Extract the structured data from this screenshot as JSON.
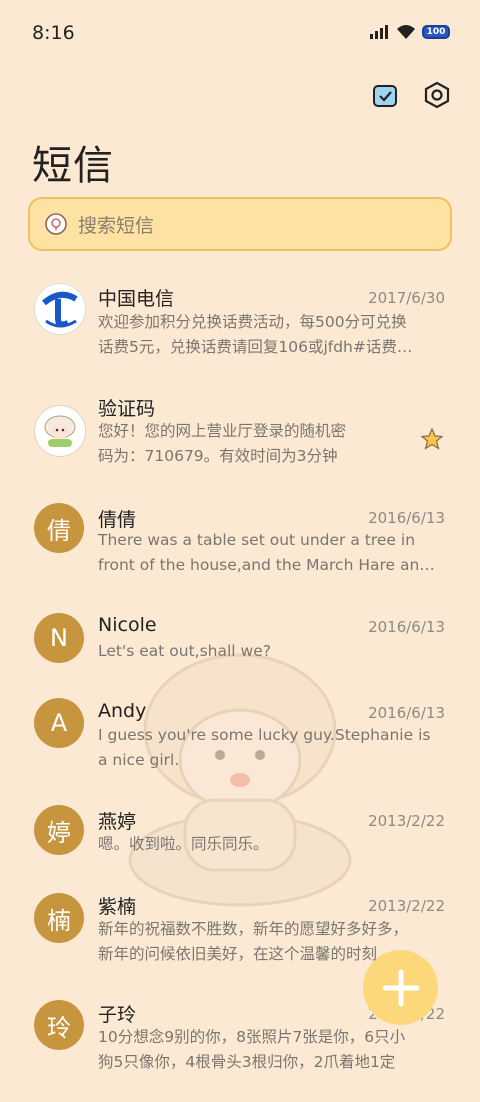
{
  "status": {
    "time": "8:16",
    "battery": "100"
  },
  "header": {
    "title": "短信"
  },
  "search": {
    "placeholder": "搜索短信"
  },
  "messages": [
    {
      "avatar": "",
      "name": "中国电信",
      "date": "2017/6/30",
      "line1": "欢迎参加积分兑换话费活动，每500分可兑换",
      "line2": "话费5元，兑换话费请回复106或jfdh#话费…"
    },
    {
      "avatar": "",
      "name": "验证码",
      "date": "",
      "line1": "您好！您的网上营业厅登录的随机密",
      "line2": "码为：710679。有效时间为3分钟"
    },
    {
      "avatar": "倩",
      "name": "倩倩",
      "date": "2016/6/13",
      "line1": "There was a table set out under a tree in",
      "line2": "front of the house,and the March Hare an…"
    },
    {
      "avatar": "N",
      "name": "Nicole",
      "date": "2016/6/13",
      "line1": "Let's eat out,shall we?",
      "line2": ""
    },
    {
      "avatar": "A",
      "name": "Andy",
      "date": "2016/6/13",
      "line1": "I guess you're some lucky guy.Stephanie is",
      "line2": "a nice girl."
    },
    {
      "avatar": "婷",
      "name": "燕婷",
      "date": "2013/2/22",
      "line1": "嗯。收到啦。同乐同乐。",
      "line2": ""
    },
    {
      "avatar": "楠",
      "name": "紫楠",
      "date": "2013/2/22",
      "line1": "新年的祝福数不胜数，新年的愿望好多好多，",
      "line2": "新年的问候依旧美好，在这个温馨的时刻…"
    },
    {
      "avatar": "玲",
      "name": "子玲",
      "date": "2013/2/22",
      "line1": "10分想念9别的你，8张照片7张是你，6只小",
      "line2": "狗5只像你，4根骨头3根归你，2爪着地1定"
    }
  ],
  "colors": {
    "accent": "#c8953f",
    "background": "#fbe9d3",
    "search_bg": "#fde2a4",
    "fab": "#fdd87a"
  },
  "icons": {
    "top_left_action": "check-calendar-icon",
    "top_right_action": "settings-hex-icon",
    "fab": "plus-icon"
  }
}
